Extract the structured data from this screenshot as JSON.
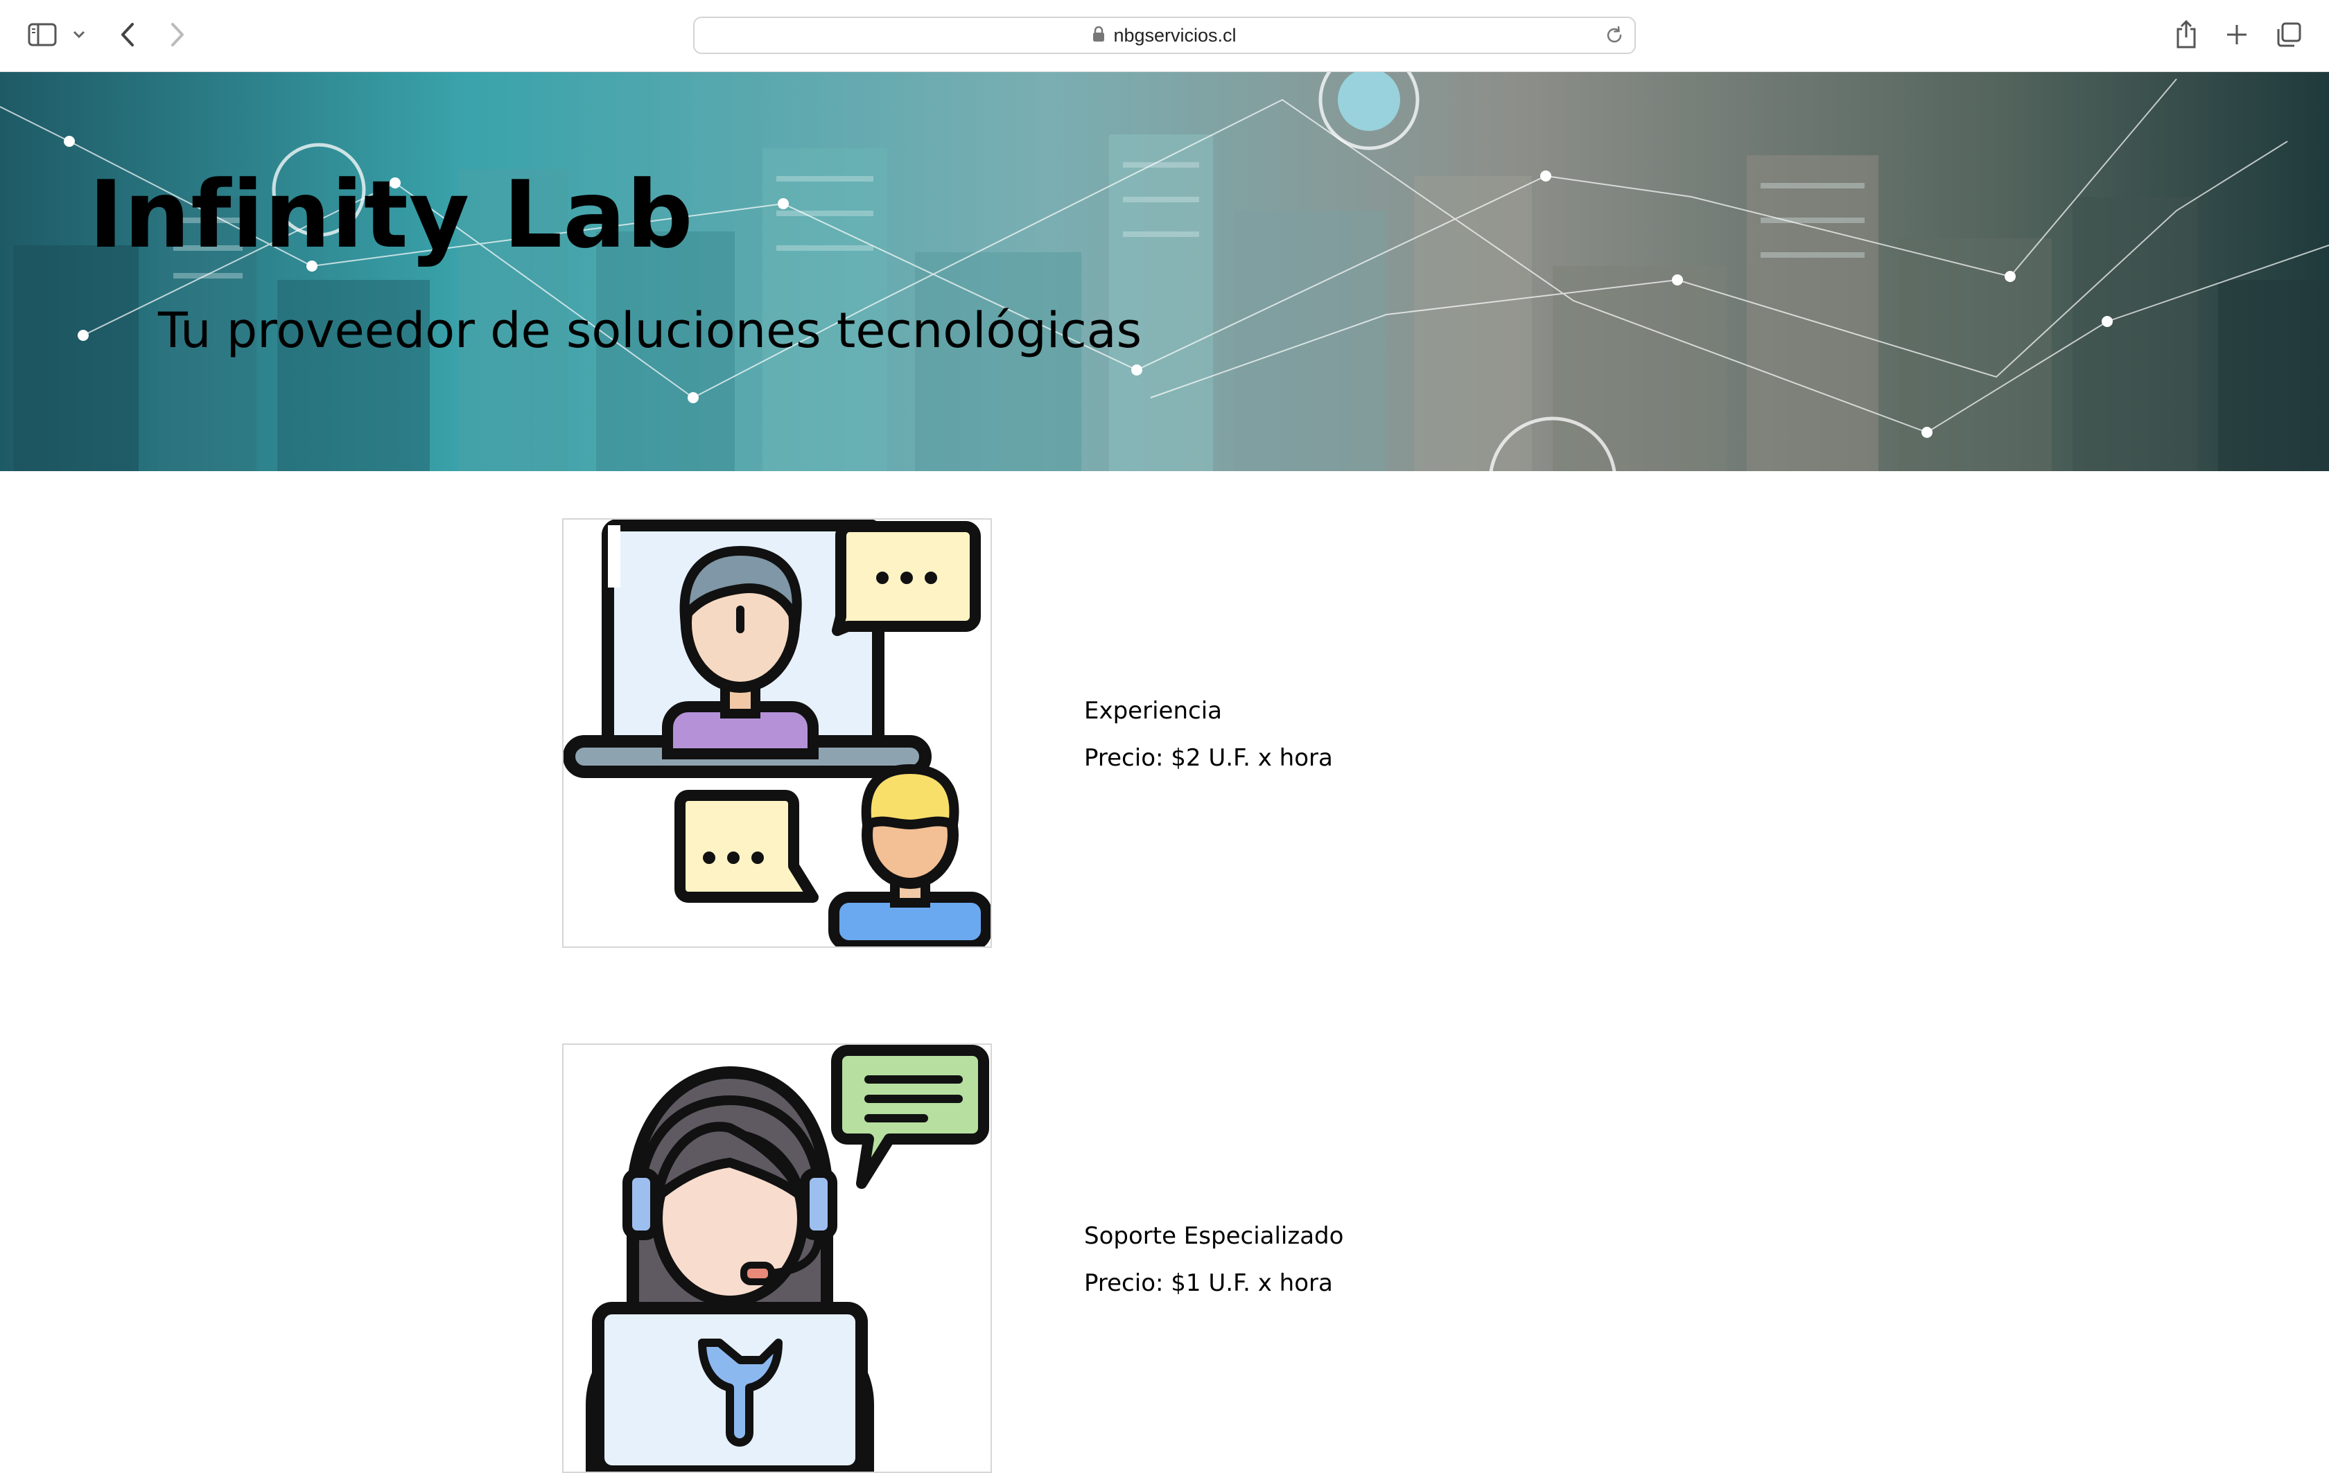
{
  "browser": {
    "url": "nbgservicios.cl"
  },
  "hero": {
    "title": "Infinity Lab",
    "subtitle": "Tu proveedor de soluciones tecnológicas"
  },
  "services": [
    {
      "name": "Experiencia",
      "price": "Precio: $2 U.F. x hora",
      "image": "video-call-illustration"
    },
    {
      "name": "Soporte Especializado",
      "price": "Precio: $1 U.F. x hora",
      "image": "support-agent-illustration"
    }
  ],
  "colors": {
    "hero_teal": "#3c8e96",
    "outline": "#111111",
    "screen_blue": "#e6f1fc",
    "bubble_yellow": "#fdf3c4",
    "shirt_purple": "#b592d8",
    "shirt_blue": "#6aa9ef",
    "bubble_green": "#b6dfa0"
  }
}
